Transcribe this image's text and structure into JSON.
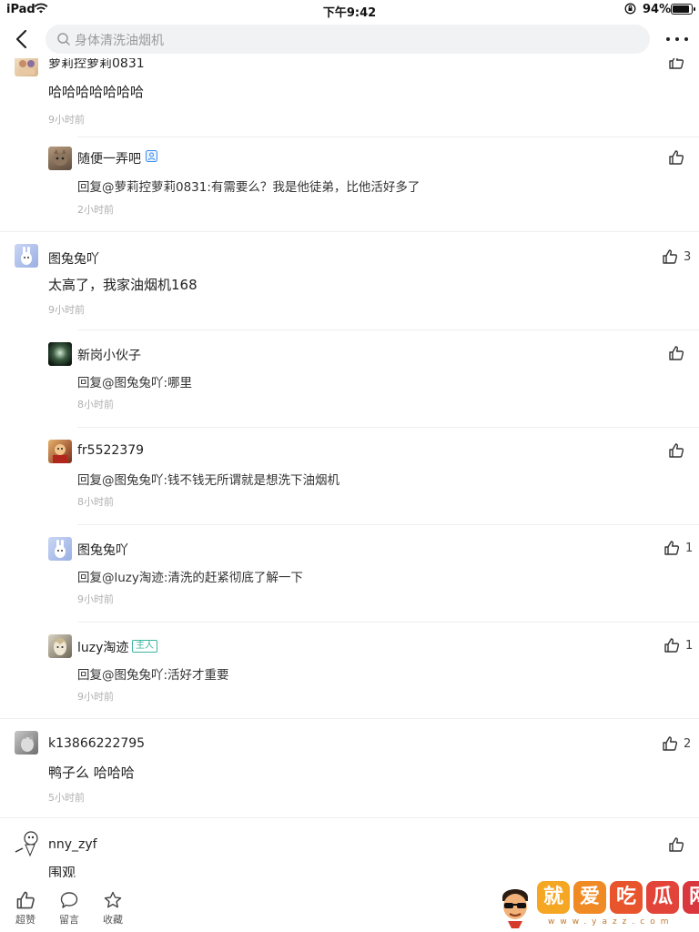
{
  "status_bar": {
    "device": "iPad",
    "time": "下午9:42",
    "battery": "94%",
    "battery_level": 0.94
  },
  "navbar": {
    "search_placeholder": "身体清洗油烟机"
  },
  "comments": [
    {
      "username": "萝莉控萝莉0831",
      "text": "哈哈哈哈哈哈哈",
      "time": "9小时前",
      "likes": ""
    },
    {
      "username": "随便一弄吧",
      "text": "回复@萝莉控萝莉0831:有需要么？我是他徒弟，比他活好多了",
      "time": "2小时前",
      "likes": ""
    },
    {
      "username": "图兔兔吖",
      "text": "太高了，我家油烟机168",
      "time": "9小时前",
      "likes": "3"
    },
    {
      "username": "新岗小伙子",
      "text": "回复@图兔兔吖:哪里",
      "time": "8小时前",
      "likes": ""
    },
    {
      "username": "fr5522379",
      "text": "回复@图兔兔吖:钱不钱无所谓就是想洗下油烟机",
      "time": "8小时前",
      "likes": ""
    },
    {
      "username": "图兔兔吖",
      "text": "回复@luzy淘迹:清洗的赶紧彻底了解一下",
      "time": "9小时前",
      "likes": "1"
    },
    {
      "username": "luzy淘迹",
      "badge": "主人",
      "text": "回复@图兔兔吖:活好才重要",
      "time": "9小时前",
      "likes": "1"
    },
    {
      "username": "k13866222795",
      "text": "鸭子么 哈哈哈",
      "time": "5小时前",
      "likes": "2"
    },
    {
      "username": "nny_zyf",
      "text": "围观",
      "time": "",
      "likes": ""
    }
  ],
  "toolbar": {
    "like_label": "超赞",
    "comment_label": "留言",
    "favorite_label": "收藏"
  },
  "watermark": {
    "chars": [
      "就",
      "爱",
      "吃",
      "瓜",
      "网"
    ],
    "url": "www.yazz.com"
  },
  "colors": {
    "accent_blue": "#3d8fe8",
    "owner_badge": "#3cb5a0",
    "time_gray": "#b0b0b0"
  }
}
